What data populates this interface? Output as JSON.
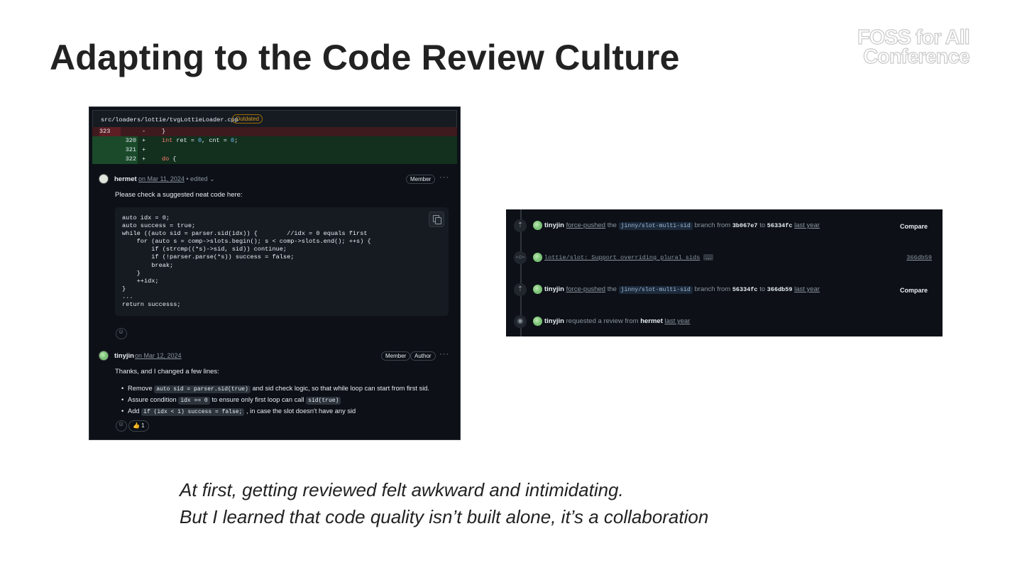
{
  "slide": {
    "title": "Adapting to the Code Review Culture",
    "logo_line1": "FOSS for All",
    "logo_line2": "Conference",
    "quote_line1": "At first, getting reviewed felt awkward and intimidating.",
    "quote_line2": "But I learned that code quality isn’t built alone, it’s a collaboration"
  },
  "review": {
    "file_path": "src/loaders/lottie/tvgLottieLoader.cpp",
    "outdated_label": "Outdated",
    "diff": [
      {
        "old": "323",
        "new": "",
        "sign": "-",
        "code": "}"
      },
      {
        "old": "",
        "new": "320",
        "sign": "+",
        "code": "int ret = 0, cnt = 0;"
      },
      {
        "old": "",
        "new": "321",
        "sign": "+",
        "code": ""
      },
      {
        "old": "",
        "new": "322",
        "sign": "+",
        "code": "do {"
      }
    ],
    "comment1": {
      "author": "hermet",
      "date": "on Mar 11, 2024",
      "edited": "• edited",
      "badge": "Member",
      "body": "Please check a suggested neat code here:",
      "code": "auto idx = 0;\nauto success = true;\nwhile ((auto sid = parser.sid(idx)) {        //idx = 0 equals first\n    for (auto s = comp->slots.begin(); s < comp->slots.end(); ++s) {\n        if (strcmp((*s)->sid, sid)) continue;\n        if (!parser.parse(*s)) success = false;\n        break;\n    }\n    ++idx;\n}\n...\nreturn successs;"
    },
    "comment2": {
      "author": "tinyjin",
      "date": "on Mar 12, 2024",
      "badge1": "Member",
      "badge2": "Author",
      "body": "Thanks, and I changed a few lines:",
      "b1_pre": "Remove",
      "b1_code": "auto sid = parser.sid(true)",
      "b1_post": "and sid check logic, so that while loop can start from first sid.",
      "b2_pre": "Assure condition",
      "b2_code": "idx == 0",
      "b2_mid": "to ensure only first loop can call",
      "b2_code2": "sid(true)",
      "b3_pre": "Add",
      "b3_code": "if (idx < 1) success = false;",
      "b3_post": ", in case the slot doesn't have any sid",
      "reaction": "👍 1"
    }
  },
  "timeline": {
    "item1": {
      "user": "tinyjin",
      "action": "force-pushed",
      "the": "the",
      "branch": "jinny/slot-multi-sid",
      "from_word": "branch from",
      "from": "3b067e7",
      "to_word": "to",
      "to": "56334fc",
      "time": "last year",
      "button": "Compare"
    },
    "item2": {
      "message": "lottie/slot: Support overriding plural sids",
      "ellipsis": "…",
      "sha": "366db59"
    },
    "item3": {
      "user": "tinyjin",
      "action": "force-pushed",
      "the": "the",
      "branch": "jinny/slot-multi-sid",
      "from_word": "branch from",
      "from": "56334fc",
      "to_word": "to",
      "to": "366db59",
      "time": "last year",
      "button": "Compare"
    },
    "item4": {
      "user": "tinyjin",
      "action": "requested a review from",
      "reviewer": "hermet",
      "time": "last year"
    }
  },
  "icons": [
    "push-icon",
    "commit-icon",
    "eye-icon",
    "copy-icon",
    "smiley-icon",
    "kebab-icon"
  ]
}
